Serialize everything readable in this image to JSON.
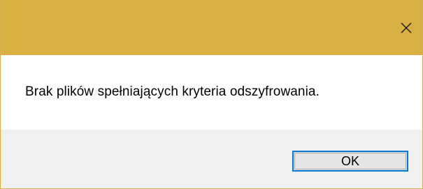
{
  "window": {
    "title": "",
    "titlebar_color": "#d9b042",
    "close_icon": "close-icon"
  },
  "message": {
    "text": "Brak plików spełniających kryteria odszyfrowania."
  },
  "buttons": {
    "ok_label": "OK",
    "ok_focus_color": "#0078d7"
  }
}
